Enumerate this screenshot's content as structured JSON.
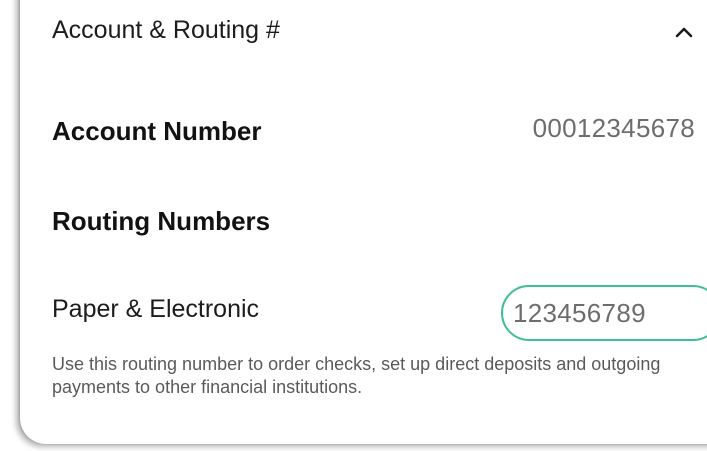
{
  "section": {
    "title": "Account & Routing #",
    "toggle_icon": "chevron-up-icon"
  },
  "account": {
    "label": "Account Number",
    "value": "00012345678"
  },
  "routing": {
    "title": "Routing Numbers",
    "paper_electronic_label": "Paper & Electronic",
    "paper_electronic_value": "123456789",
    "help_text": "Use this routing number to order checks, set up direct deposits and outgoing payments to other financial institutions."
  },
  "colors": {
    "highlight_border": "#3fbf93",
    "value_text": "#6d6d6d"
  }
}
